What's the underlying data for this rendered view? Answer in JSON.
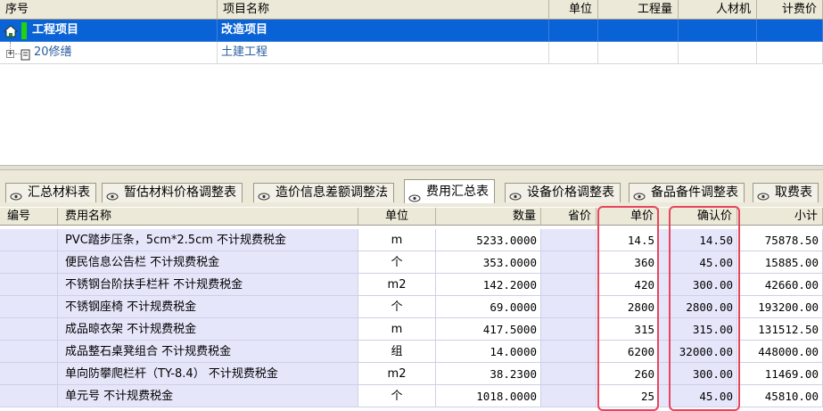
{
  "top_grid": {
    "headers": [
      "序号",
      "项目名称",
      "单位",
      "工程量",
      "人材机",
      "计费价"
    ],
    "rows": [
      {
        "code": "工程项目",
        "name": "改造项目"
      },
      {
        "code": "20修缮",
        "name": "土建工程"
      }
    ]
  },
  "tabs": [
    "汇总材料表",
    "暂估材料价格调整表",
    "造价信息差额调整法",
    "费用汇总表",
    "设备价格调整表",
    "备品备件调整表",
    "取费表"
  ],
  "active_tab": "费用汇总表",
  "table": {
    "headers": [
      "编号",
      "费用名称",
      "单位",
      "数量",
      "省价",
      "单价",
      "确认价",
      "小计"
    ],
    "rows": [
      {
        "name": "PVC踏步压条，5cm*2.5cm 不计规费税金",
        "unit": "m",
        "qty": "5233.0000",
        "price": "14.5",
        "confirmed": "14.50",
        "subtotal": "75878.50"
      },
      {
        "name": "便民信息公告栏 不计规费税金",
        "unit": "个",
        "qty": "353.0000",
        "price": "360",
        "confirmed": "45.00",
        "subtotal": "15885.00"
      },
      {
        "name": "不锈钢台阶扶手栏杆 不计规费税金",
        "unit": "m2",
        "qty": "142.2000",
        "price": "420",
        "confirmed": "300.00",
        "subtotal": "42660.00"
      },
      {
        "name": "不锈钢座椅 不计规费税金",
        "unit": "个",
        "qty": "69.0000",
        "price": "2800",
        "confirmed": "2800.00",
        "subtotal": "193200.00"
      },
      {
        "name": "成品晾衣架 不计规费税金",
        "unit": "m",
        "qty": "417.5000",
        "price": "315",
        "confirmed": "315.00",
        "subtotal": "131512.50"
      },
      {
        "name": "成品整石桌凳组合 不计规费税金",
        "unit": "组",
        "qty": "14.0000",
        "price": "6200",
        "confirmed": "32000.00",
        "subtotal": "448000.00"
      },
      {
        "name": "单向防攀爬栏杆（TY-8.4） 不计规费税金",
        "unit": "m2",
        "qty": "38.2300",
        "price": "260",
        "confirmed": "300.00",
        "subtotal": "11469.00"
      },
      {
        "name": "单元号 不计规费税金",
        "unit": "个",
        "qty": "1018.0000",
        "price": "25",
        "confirmed": "45.00",
        "subtotal": "45810.00"
      }
    ]
  },
  "colors": {
    "selection": "#0a63d6",
    "highlight_box": "#e8455f",
    "lavender": "#e6e6fb"
  }
}
